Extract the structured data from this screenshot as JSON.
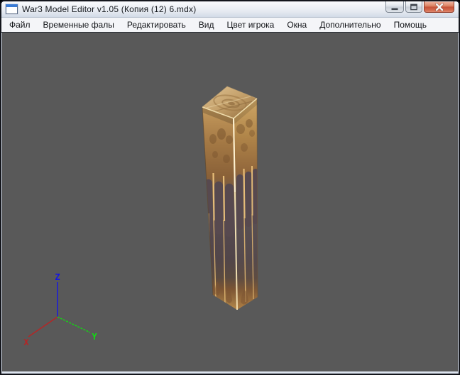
{
  "window": {
    "title": "War3 Model Editor v1.05 (Копия (12) 6.mdx)"
  },
  "menu": {
    "items": [
      "Файл",
      "Временные фалы",
      "Редактировать",
      "Вид",
      "Цвет игрока",
      "Окна",
      "Дополнительно",
      "Помощь"
    ]
  },
  "viewport": {
    "background_color": "#595959",
    "axes": {
      "x": {
        "label": "X",
        "color": "#b62525"
      },
      "y": {
        "label": "Y",
        "color": "#12d812"
      },
      "z": {
        "label": "Z",
        "color": "#1515e6"
      }
    },
    "model": {
      "description": "textured wooden pillar (mdx model)",
      "palette": {
        "top_face_light": "#dfc394",
        "top_face_dark": "#8f6a3c",
        "side_gold_top": "#c59a5d",
        "side_gold_mid": "#a37844",
        "side_dark_plum": "#564a51",
        "side_ember": "#7d5533",
        "tip_gold": "#b98a4a",
        "stripe_gold": "#e2b873",
        "spike_gold": "#ecc27c",
        "edge_highlight": "#f5e4b5",
        "knot_brown": "#6f4b28",
        "arch_dark": "#57494f"
      }
    }
  }
}
